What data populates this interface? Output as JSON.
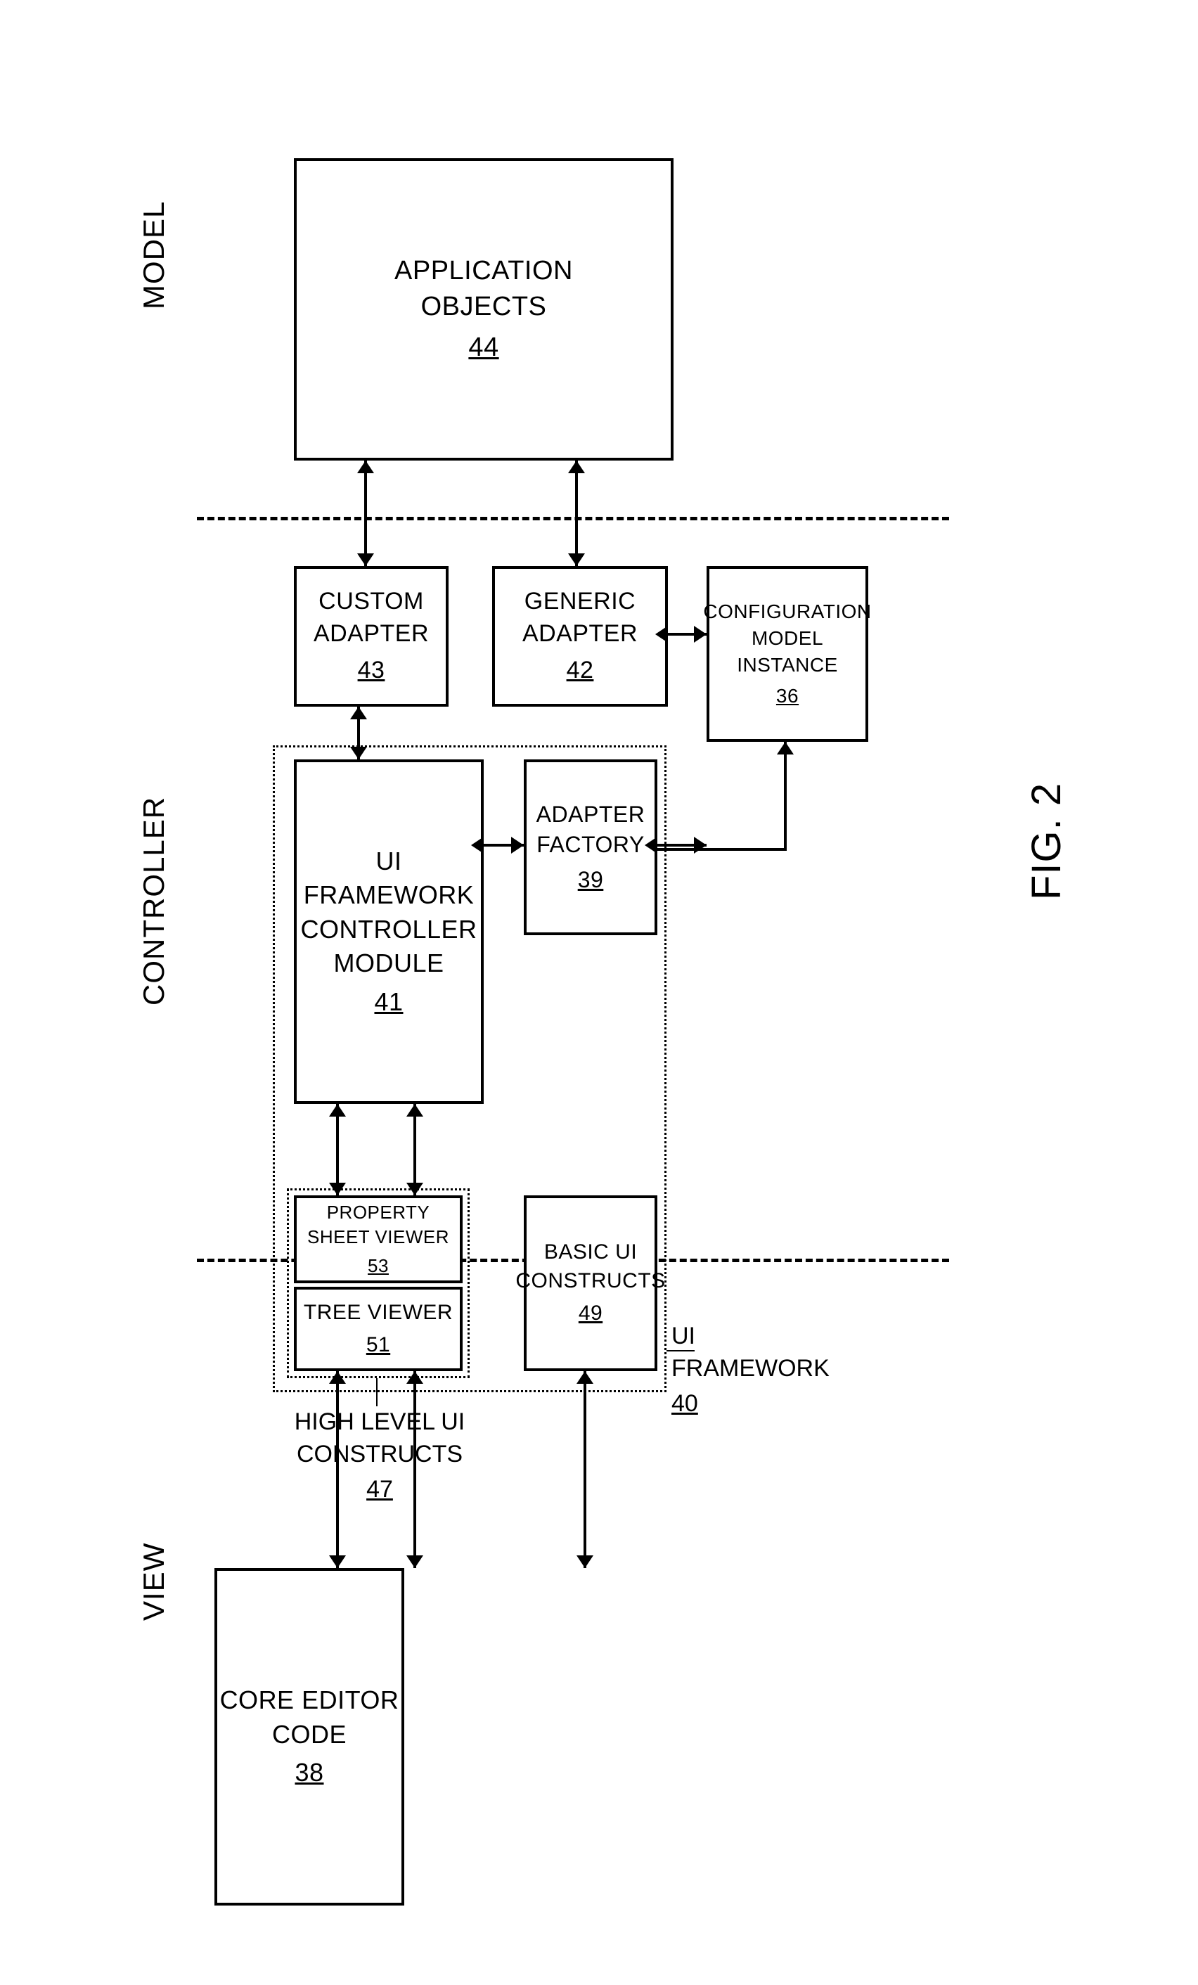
{
  "sections": {
    "view": "VIEW",
    "controller": "CONTROLLER",
    "model": "MODEL"
  },
  "blocks": {
    "core_editor": {
      "title": "CORE EDITOR\nCODE",
      "num": "38"
    },
    "tree_viewer": {
      "title": "TREE VIEWER",
      "num": "51"
    },
    "property_sheet": {
      "title": "PROPERTY\nSHEET VIEWER",
      "num": "53"
    },
    "basic_ui": {
      "title": "BASIC UI\nCONSTRUCTS",
      "num": "49"
    },
    "ui_controller": {
      "title": "UI FRAMEWORK\nCONTROLLER\nMODULE",
      "num": "41"
    },
    "adapter_factory": {
      "title": "ADAPTER\nFACTORY",
      "num": "39"
    },
    "custom_adapter": {
      "title": "CUSTOM\nADAPTER",
      "num": "43"
    },
    "generic_adapter": {
      "title": "GENERIC\nADAPTER",
      "num": "42"
    },
    "config_model": {
      "title": "CONFIGURATION\nMODEL\nINSTANCE",
      "num": "36"
    },
    "app_objects": {
      "title": "APPLICATION\nOBJECTS",
      "num": "44"
    }
  },
  "groups": {
    "high_level": {
      "label": "HIGH LEVEL UI\nCONSTRUCTS",
      "num": "47"
    },
    "ui_framework": {
      "label": "UI FRAMEWORK",
      "num": "40"
    }
  },
  "caption": "FIG. 2"
}
